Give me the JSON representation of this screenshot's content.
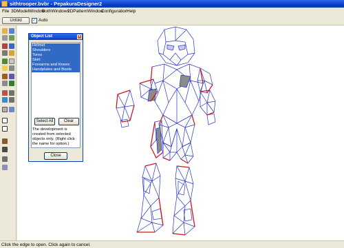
{
  "window": {
    "title": "sithtrooper.bvbr - PepakuraDesigner2"
  },
  "menu": {
    "items": [
      "File",
      "3DModelWindow",
      "BothWindows",
      "2DPatternWindow",
      "Configuration",
      "Help"
    ]
  },
  "toolbar": {
    "unfold_label": "Unfold",
    "auto_label": "Auto",
    "auto_checked": "✓"
  },
  "object_list": {
    "title": "Object List",
    "close_glyph": "x",
    "items": [
      "Helmet",
      "Shoulders",
      "Torso",
      "Skirt",
      "Forearms and Knees",
      "Handplates and Boots"
    ],
    "select_all_label": "Select All",
    "clear_label": "Clear",
    "note": "The development is created from selected objects only. (Right click the name for option.)",
    "close_label": "Close"
  },
  "status": {
    "text": "Click the edge to open. Click again to cancel."
  },
  "colors": {
    "titlebar": "#0a3fc4",
    "selection": "#316ac5",
    "mesh_blue": "#2232c8",
    "mesh_red": "#d8161c",
    "mesh_gray": "#8b8b8b"
  }
}
